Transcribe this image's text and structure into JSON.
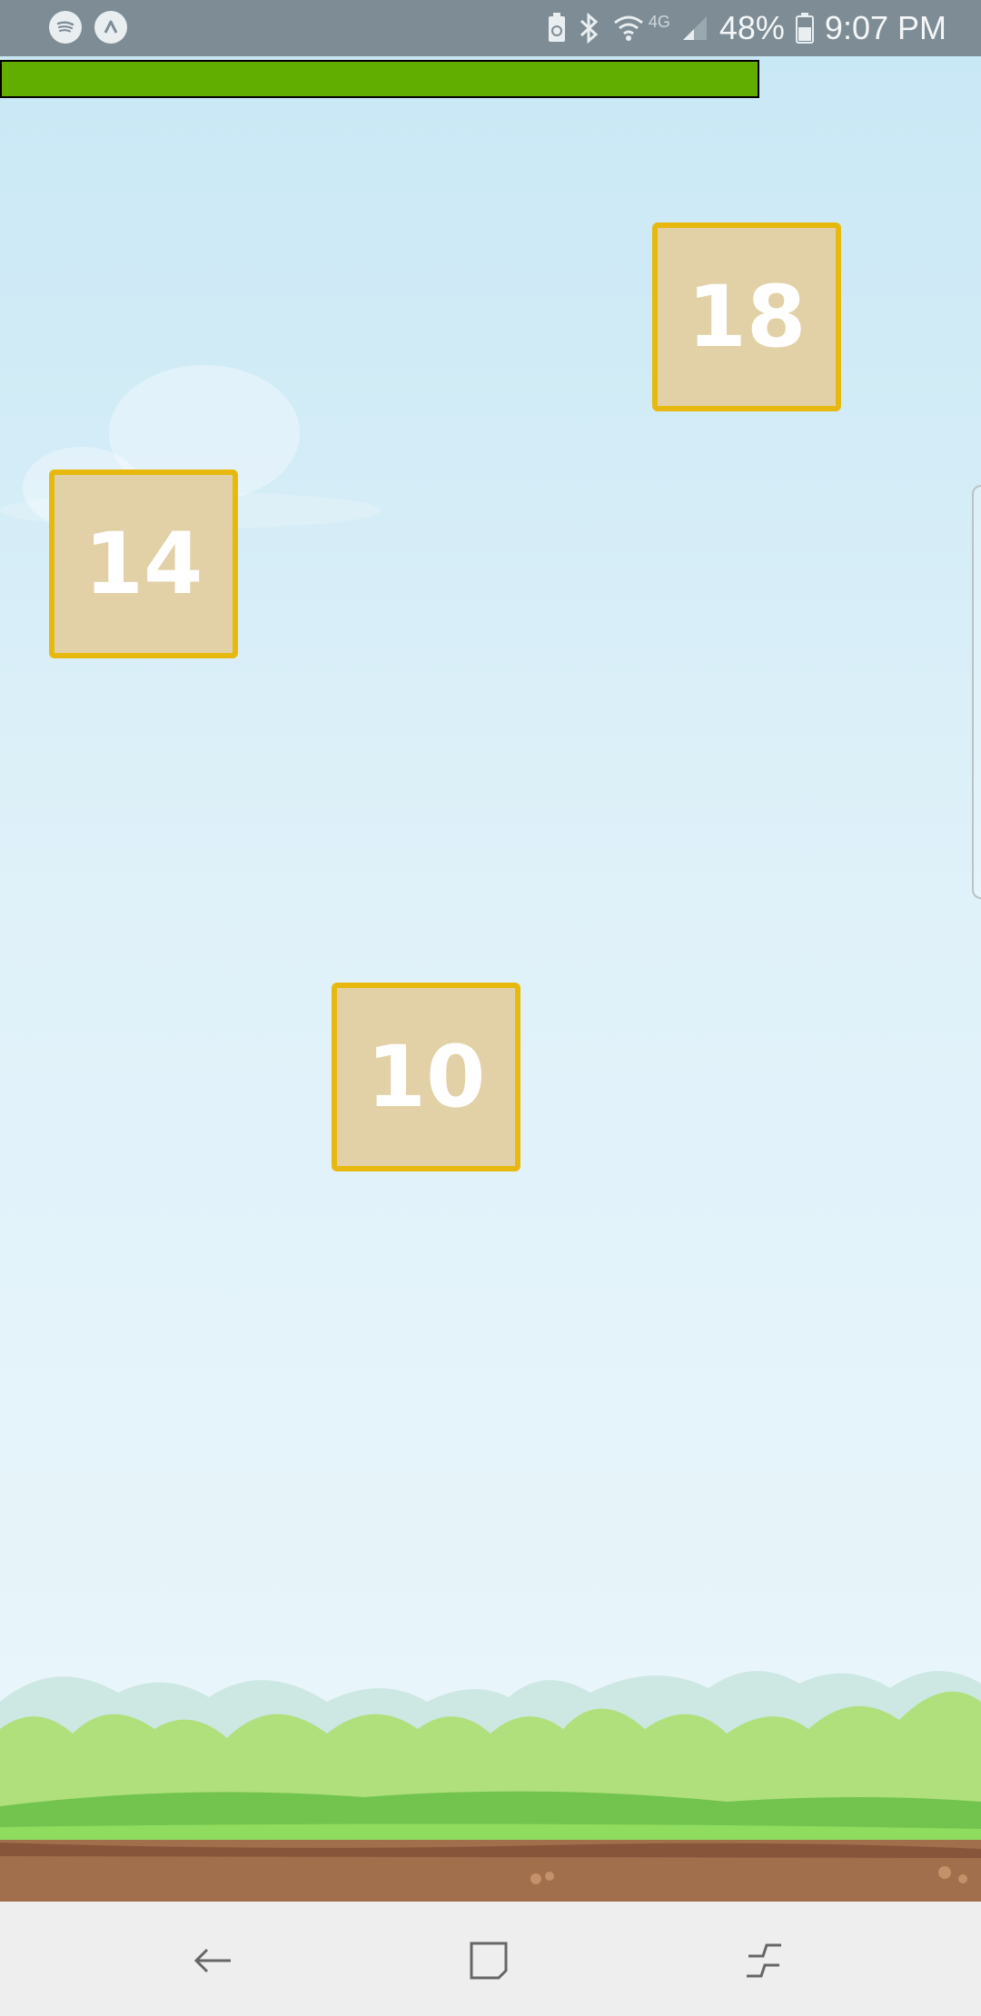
{
  "status_bar": {
    "battery_percent": "48%",
    "time": "9:07 PM",
    "network_label": "4G",
    "left_icons": [
      "spotify-icon",
      "arrow-up-app-icon"
    ],
    "right_icons": [
      "battery-saver-icon",
      "bluetooth-icon",
      "wifi-icon",
      "signal-icon",
      "battery-icon"
    ]
  },
  "game": {
    "progress_fraction": 0.77,
    "progress_color": "#62ae00",
    "tiles": [
      {
        "value": "18"
      },
      {
        "value": "14"
      },
      {
        "value": "10"
      }
    ],
    "tile_colors": {
      "fill": "#e2d1a6",
      "border": "#e7b90f",
      "text": "#ffffff"
    }
  },
  "nav_bar": {
    "buttons": [
      "back-icon",
      "recents-icon",
      "home-icon"
    ]
  }
}
